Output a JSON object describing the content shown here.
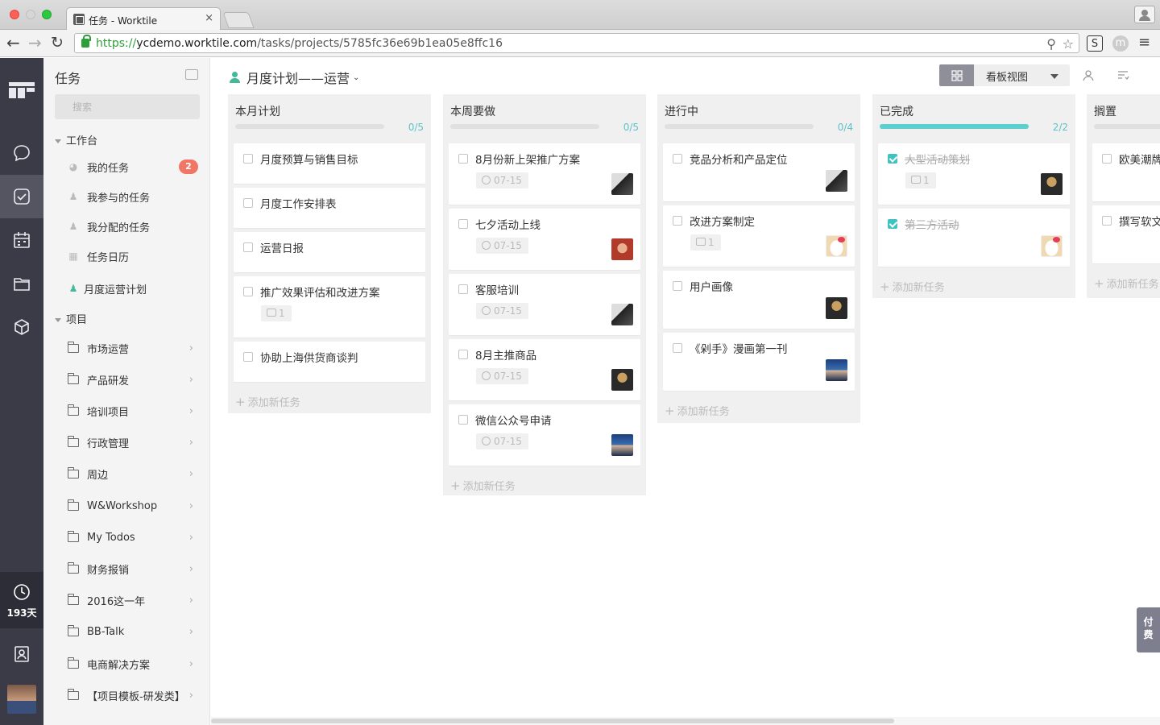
{
  "browser": {
    "tab_title": "任务 - Worktile",
    "tab_close": "×",
    "url_scheme": "https://",
    "url_host": "ycdemo.worktile.com",
    "url_path": "/tasks/projects/5785fc36e69b1ea05e8ffc16",
    "extensions": [
      "S",
      "m"
    ]
  },
  "rail": {
    "items": [
      "dashboard-icon",
      "chat-icon",
      "tasks-icon",
      "calendar-icon",
      "folder-icon",
      "box-icon",
      "contacts-icon"
    ],
    "trial_days": "193天"
  },
  "nav": {
    "title": "任务",
    "search_placeholder": "搜索",
    "workbench": {
      "label": "工作台",
      "items": [
        {
          "label": "我的任务",
          "icon": "gauge-icon",
          "badge": "2"
        },
        {
          "label": "我参与的任务",
          "icon": "people-icon"
        },
        {
          "label": "我分配的任务",
          "icon": "assign-icon"
        },
        {
          "label": "任务日历",
          "icon": "calendar-icon"
        }
      ]
    },
    "current_project": "月度运营计划",
    "projects": {
      "label": "项目",
      "items": [
        "市场运营",
        "产品研发",
        "培训项目",
        "行政管理",
        "周边",
        "W&Workshop",
        "My Todos",
        "财务报销",
        "2016这一年",
        "BB-Talk",
        "电商解决方案",
        "【项目模板-研发类】"
      ]
    }
  },
  "main": {
    "project_title": "月度计划——运营",
    "view_label": "看板视图",
    "add_task_label": "添加新任务",
    "pay_label": "付费",
    "columns": [
      {
        "name": "本月计划",
        "count": "0/5",
        "progress": 0,
        "cards": [
          {
            "title": "月度预算与销售目标"
          },
          {
            "title": "月度工作安排表"
          },
          {
            "title": "运营日报"
          },
          {
            "title": "推广效果评估和改进方案",
            "comments": "1"
          },
          {
            "title": "协助上海供货商谈判"
          }
        ]
      },
      {
        "name": "本周要做",
        "count": "0/5",
        "progress": 0,
        "cards": [
          {
            "title": "8月份新上架推广方案",
            "date": "07-15"
          },
          {
            "title": "七夕活动上线",
            "date": "07-15"
          },
          {
            "title": "客服培训",
            "date": "07-15"
          },
          {
            "title": "8月主推商品",
            "date": "07-15"
          },
          {
            "title": "微信公众号申请",
            "date": "07-15"
          }
        ]
      },
      {
        "name": "进行中",
        "count": "0/4",
        "progress": 0,
        "cards": [
          {
            "title": "竞品分析和产品定位"
          },
          {
            "title": "改进方案制定",
            "comments": "1"
          },
          {
            "title": "用户画像"
          },
          {
            "title": "《剁手》漫画第一刊"
          }
        ]
      },
      {
        "name": "已完成",
        "count": "2/2",
        "progress": 1,
        "cards": [
          {
            "title": "大型活动策划",
            "comments": "1",
            "done": true
          },
          {
            "title": "第三方活动",
            "done": true
          }
        ]
      },
      {
        "name": "搁置",
        "count": "",
        "progress": 0,
        "cards": [
          {
            "title": "欧美潮牌"
          },
          {
            "title": "撰写软文"
          }
        ]
      }
    ]
  }
}
